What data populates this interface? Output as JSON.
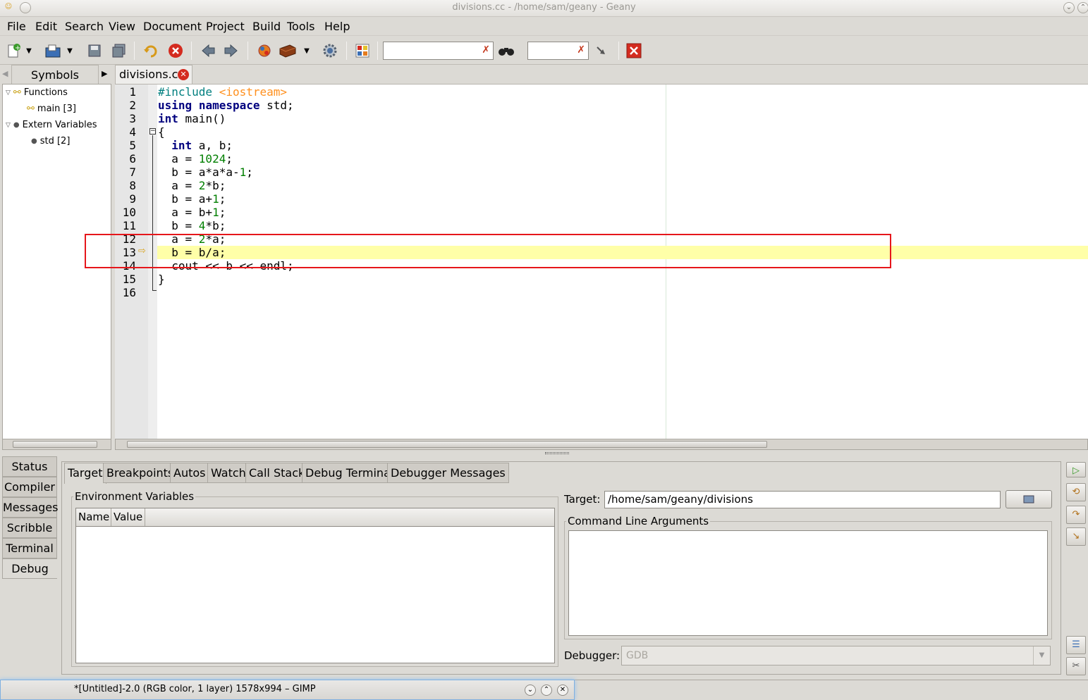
{
  "window": {
    "title": "divisions.cc - /home/sam/geany - Geany"
  },
  "menu": {
    "file": "File",
    "edit": "Edit",
    "search": "Search",
    "view": "View",
    "document": "Document",
    "project": "Project",
    "build": "Build",
    "tools": "Tools",
    "help": "Help"
  },
  "toolbar": {
    "search_value": "",
    "goto_value": ""
  },
  "sidebar": {
    "tab": "Symbols",
    "tree": {
      "functions": "Functions",
      "main": "main [3]",
      "extern": "Extern Variables",
      "std": "std [2]"
    }
  },
  "editor": {
    "tab_name": "divisions.cc",
    "lines": [
      "1",
      "2",
      "3",
      "4",
      "5",
      "6",
      "7",
      "8",
      "9",
      "10",
      "11",
      "12",
      "13",
      "14",
      "15",
      "16"
    ],
    "code": {
      "l1_a": "#include ",
      "l1_b": "<iostream>",
      "l2_a": "using",
      "l2_b": " ",
      "l2_c": "namespace",
      "l2_d": " std;",
      "l3_a": "int",
      "l3_b": " main()",
      "l4": "{",
      "l5_a": "  ",
      "l5_b": "int",
      "l5_c": " a, b;",
      "l6_a": "  a = ",
      "l6_b": "1024",
      "l6_c": ";",
      "l7_a": "  b = a*a*a-",
      "l7_b": "1",
      "l7_c": ";",
      "l8_a": "  a = ",
      "l8_b": "2",
      "l8_c": "*b;",
      "l9_a": "  b = a+",
      "l9_b": "1",
      "l9_c": ";",
      "l10_a": "  a = b+",
      "l10_b": "1",
      "l10_c": ";",
      "l11_a": "  b = ",
      "l11_b": "4",
      "l11_c": "*b;",
      "l12_a": "  a = ",
      "l12_b": "2",
      "l12_c": "*a;",
      "l13": "  b = b/a;",
      "l14": "  cout << b << endl;",
      "l15": "}"
    }
  },
  "bottom": {
    "tabs": [
      "Status",
      "Compiler",
      "Messages",
      "Scribble",
      "Terminal",
      "Debug"
    ],
    "debug_tabs": [
      "Target",
      "Breakpoints",
      "Autos",
      "Watch",
      "Call Stack",
      "Debug Terminal",
      "Debugger Messages"
    ],
    "env_label": "Environment Variables",
    "col_name": "Name",
    "col_value": "Value",
    "target_label": "Target:",
    "target_value": "/home/sam/geany/divisions",
    "cmd_label": "Command Line Arguments",
    "debugger_label": "Debugger:",
    "debugger_value": "GDB"
  },
  "taskbar": {
    "gimp_title": "*[Untitled]-2.0 (RGB color, 1 layer) 1578x994 – GIMP"
  }
}
